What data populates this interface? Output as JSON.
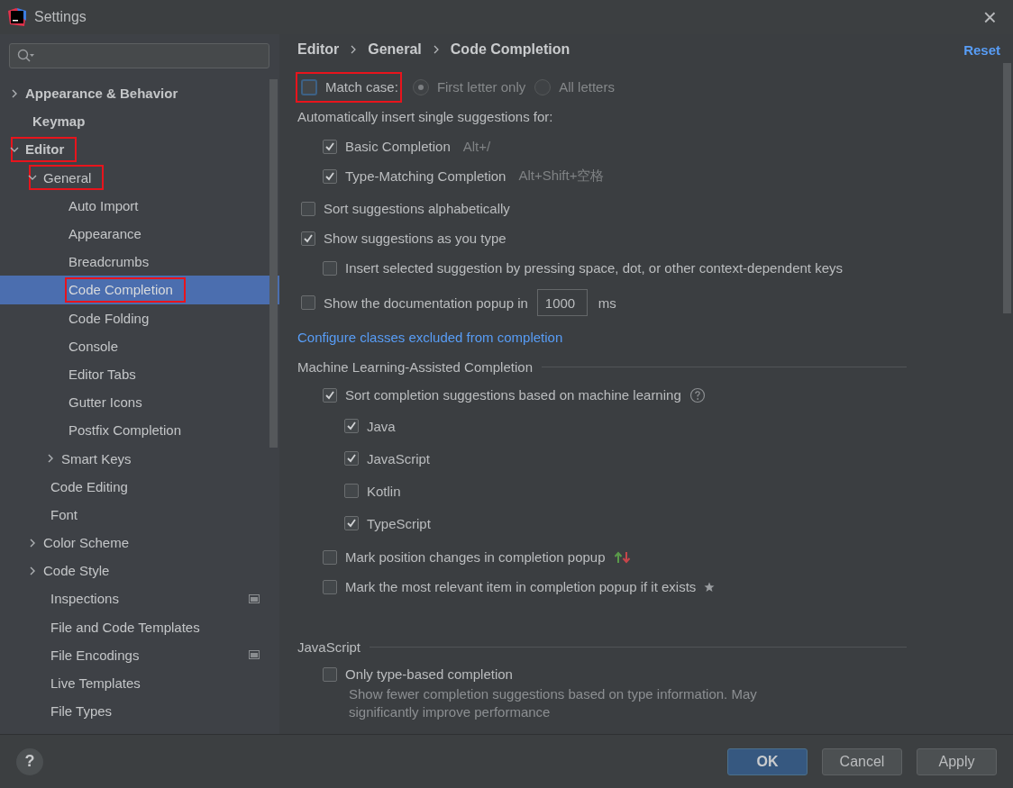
{
  "window": {
    "title": "Settings",
    "close": "×"
  },
  "sidebar": {
    "items": [
      {
        "label": "Appearance & Behavior",
        "bold": true,
        "expanded": false,
        "selected": false,
        "marked": false
      },
      {
        "label": "Keymap",
        "bold": true,
        "selected": false,
        "marked": false
      },
      {
        "label": "Editor",
        "bold": true,
        "expanded": true,
        "selected": false,
        "marked": true,
        "children": [
          {
            "label": "General",
            "expanded": true,
            "selected": false,
            "marked": true,
            "children": [
              {
                "label": "Auto Import",
                "selected": false,
                "marked": false
              },
              {
                "label": "Appearance",
                "selected": false,
                "marked": false
              },
              {
                "label": "Breadcrumbs",
                "selected": false,
                "marked": false
              },
              {
                "label": "Code Completion",
                "selected": true,
                "marked": true
              },
              {
                "label": "Code Folding",
                "selected": false,
                "marked": false
              },
              {
                "label": "Console",
                "selected": false,
                "marked": false
              },
              {
                "label": "Editor Tabs",
                "selected": false,
                "marked": false
              },
              {
                "label": "Gutter Icons",
                "selected": false,
                "marked": false
              },
              {
                "label": "Postfix Completion",
                "selected": false,
                "marked": false
              },
              {
                "label": "Smart Keys",
                "expanded": false,
                "selected": false,
                "marked": false
              }
            ]
          },
          {
            "label": "Code Editing",
            "selected": false,
            "marked": false
          },
          {
            "label": "Font",
            "selected": false,
            "marked": false
          },
          {
            "label": "Color Scheme",
            "expanded": false,
            "selected": false,
            "marked": false
          },
          {
            "label": "Code Style",
            "expanded": false,
            "selected": false,
            "marked": false
          },
          {
            "label": "Inspections",
            "scope_icon": true,
            "selected": false,
            "marked": false
          },
          {
            "label": "File and Code Templates",
            "selected": false,
            "marked": false
          },
          {
            "label": "File Encodings",
            "scope_icon": true,
            "selected": false,
            "marked": false
          },
          {
            "label": "Live Templates",
            "selected": false,
            "marked": false
          },
          {
            "label": "File Types",
            "selected": false,
            "marked": false
          }
        ]
      }
    ]
  },
  "breadcrumb": [
    "Editor",
    "General",
    "Code Completion"
  ],
  "reset": "Reset",
  "options": [
    {
      "kind": "match_case",
      "label": "Match case:",
      "checked": false,
      "marked": true,
      "radios": [
        {
          "label": "First letter only",
          "selected": true,
          "disabled": true
        },
        {
          "label": "All letters",
          "selected": false,
          "disabled": true
        }
      ]
    },
    {
      "kind": "label",
      "label": "Automatically insert single suggestions for:",
      "children": [
        {
          "kind": "checkbox",
          "label": "Basic Completion",
          "shortcut": "Alt+/",
          "checked": true
        },
        {
          "kind": "checkbox",
          "label": "Type-Matching Completion",
          "shortcut": "Alt+Shift+空格",
          "checked": true
        }
      ]
    },
    {
      "kind": "checkbox",
      "label": "Sort suggestions alphabetically",
      "checked": false
    },
    {
      "kind": "checkbox",
      "label": "Show suggestions as you type",
      "checked": true,
      "children": [
        {
          "kind": "checkbox",
          "label": "Insert selected suggestion by pressing space, dot, or other context-dependent keys",
          "checked": false
        }
      ]
    },
    {
      "kind": "number",
      "label": "Show the documentation popup in",
      "checked": false,
      "value": "1000",
      "unit": "ms"
    },
    {
      "kind": "link",
      "label": "Configure classes excluded from completion"
    },
    {
      "kind": "section",
      "label": "Machine Learning-Assisted Completion",
      "children": [
        {
          "kind": "checkbox",
          "label": "Sort completion suggestions based on machine learning",
          "checked": true,
          "help_icon": true,
          "children": [
            {
              "kind": "checkbox",
              "label": "Java",
              "checked": true
            },
            {
              "kind": "checkbox",
              "label": "JavaScript",
              "checked": true
            },
            {
              "kind": "checkbox",
              "label": "Kotlin",
              "checked": false
            },
            {
              "kind": "checkbox",
              "label": "TypeScript",
              "checked": true
            }
          ]
        },
        {
          "kind": "checkbox",
          "label": "Mark position changes in completion popup",
          "checked": false,
          "arrows_icon": true
        },
        {
          "kind": "checkbox",
          "label": "Mark the most relevant item in completion popup if it exists",
          "checked": false,
          "star_icon": true
        }
      ]
    },
    {
      "kind": "section",
      "label": "JavaScript",
      "children": [
        {
          "kind": "checkbox",
          "label": "Only type-based completion",
          "checked": false,
          "description": "Show fewer completion suggestions based on type information. May significantly improve performance"
        }
      ]
    }
  ],
  "footer": {
    "help": "?",
    "buttons": [
      {
        "label": "OK",
        "default": true
      },
      {
        "label": "Cancel",
        "default": false
      },
      {
        "label": "Apply",
        "default": false
      }
    ]
  }
}
